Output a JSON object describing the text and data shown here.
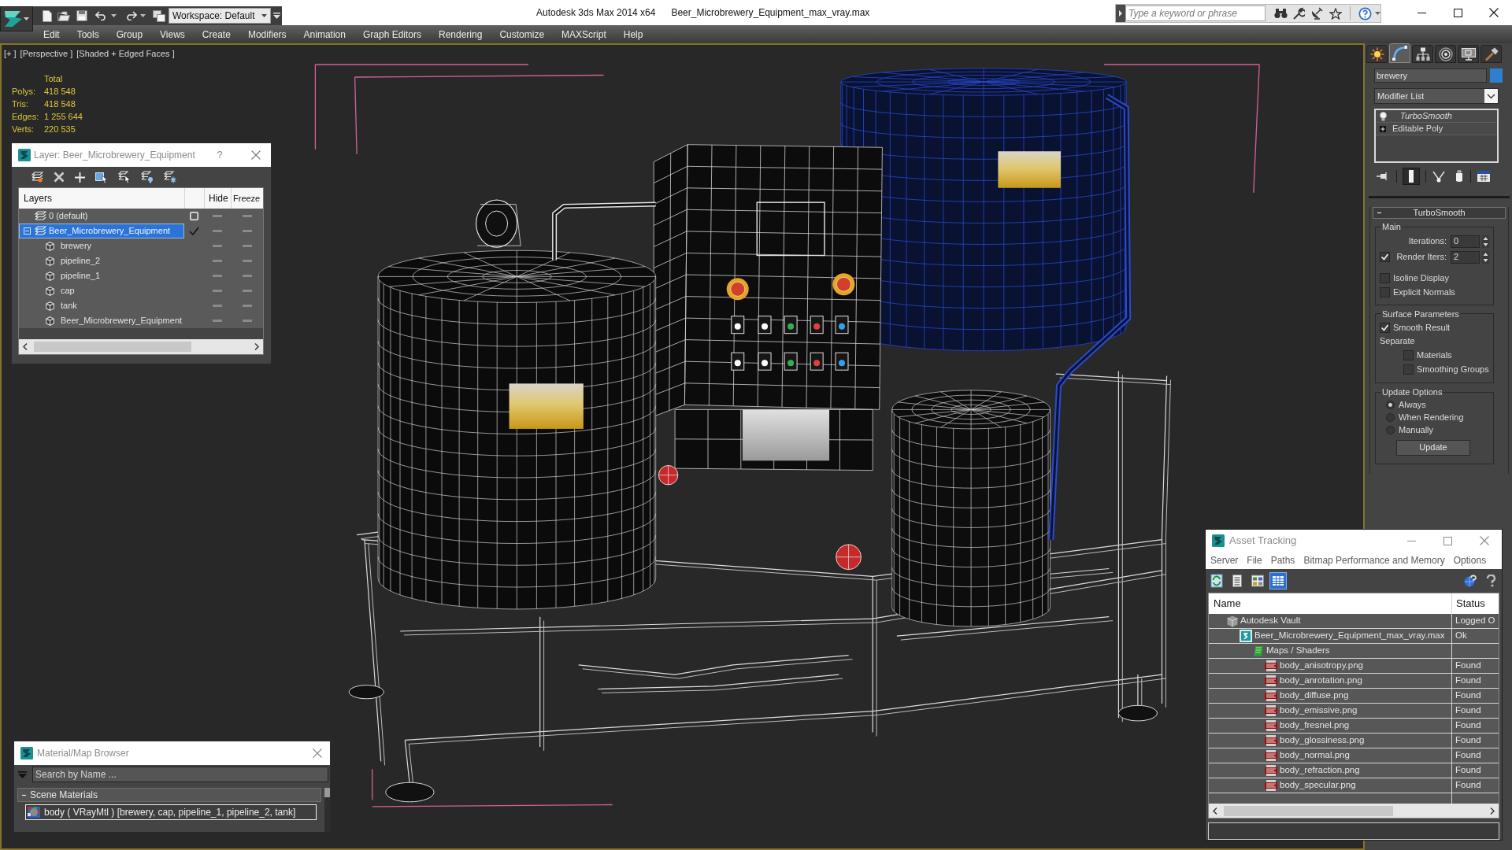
{
  "title_bar": {
    "workspace": "Workspace: Default",
    "app_title": "Autodesk 3ds Max 2014 x64",
    "file_name": "Beer_Microbrewery_Equipment_max_vray.max",
    "search": {
      "placeholder": "Type a keyword or phrase"
    }
  },
  "menu": [
    "Edit",
    "Tools",
    "Group",
    "Views",
    "Create",
    "Modifiers",
    "Animation",
    "Graph Editors",
    "Rendering",
    "Customize",
    "MAXScript",
    "Help"
  ],
  "viewport": {
    "labels": [
      "[+ ]",
      "[Perspective ]",
      "[Shaded + Edged Faces ]"
    ],
    "stats": {
      "header": "Total",
      "rows": [
        {
          "label": "Polys:",
          "value": "418 548"
        },
        {
          "label": "Tris:",
          "value": "418 548"
        },
        {
          "label": "Edges:",
          "value": "1 255 644"
        },
        {
          "label": "Verts:",
          "value": "220 535"
        }
      ]
    }
  },
  "layer_dialog": {
    "title": "Layer: Beer_Microbrewery_Equipment",
    "help": "?",
    "columns": {
      "name": "Layers",
      "hide": "Hide",
      "freeze": "Freeze"
    },
    "layers": [
      {
        "name": "0 (default)",
        "kind": "layer",
        "current": false,
        "selected": false,
        "hidden": false,
        "frozen": false
      },
      {
        "name": "Beer_Microbrewery_Equipment",
        "kind": "layer",
        "current": true,
        "selected": true,
        "expanded": true,
        "hidden": false,
        "frozen": false,
        "children": [
          {
            "name": "brewery",
            "kind": "object",
            "selected": false,
            "hidden": false,
            "frozen": false
          },
          {
            "name": "pipeline_2",
            "kind": "object",
            "selected": false,
            "hidden": false,
            "frozen": false
          },
          {
            "name": "pipeline_1",
            "kind": "object",
            "selected": false,
            "hidden": false,
            "frozen": false
          },
          {
            "name": "cap",
            "kind": "object",
            "selected": false,
            "hidden": false,
            "frozen": false
          },
          {
            "name": "tank",
            "kind": "object",
            "selected": false,
            "hidden": false,
            "frozen": false
          },
          {
            "name": "Beer_Microbrewery_Equipment",
            "kind": "object",
            "selected": false,
            "hidden": false,
            "frozen": false
          }
        ]
      }
    ]
  },
  "material_browser": {
    "title": "Material/Map Browser",
    "search": {
      "placeholder": "Search by Name ..."
    },
    "groups": [
      {
        "title": "Scene Materials",
        "expanded": true,
        "items": [
          {
            "name": "body ( VRayMtl ) [brewery, cap, pipeline_1, pipeline_2, tank]",
            "selected": true
          }
        ]
      }
    ]
  },
  "command_panel": {
    "tabs": [
      {
        "selected": false
      },
      {
        "selected": true
      },
      {
        "selected": false
      },
      {
        "selected": false
      },
      {
        "selected": false
      },
      {
        "selected": false
      }
    ],
    "object": {
      "name": "brewery",
      "color": "#2f7fd0"
    },
    "modifier_list": "Modifier List",
    "modifier_stack": [
      {
        "name": "TurboSmooth",
        "kind": "modifier",
        "on": true
      },
      {
        "name": "Editable Poly",
        "kind": "object",
        "expanded": false
      }
    ],
    "stack_tools": [
      {
        "on": false
      },
      {
        "on": true
      },
      {
        "on": false
      },
      {
        "on": false
      },
      {
        "on": false
      }
    ],
    "rollout": {
      "title": "TurboSmooth",
      "expanded": true,
      "groups": [
        {
          "title": "Main",
          "controls": [
            {
              "kind": "spinner",
              "label": "Iterations:",
              "value": "0"
            },
            {
              "kind": "check-spinner",
              "label": "Render Iters:",
              "value": "2",
              "checked": true
            },
            {
              "kind": "checkbox",
              "label": "Isoline Display",
              "checked": false
            },
            {
              "kind": "checkbox",
              "label": "Explicit Normals",
              "checked": false
            }
          ]
        },
        {
          "title": "Surface Parameters",
          "controls": [
            {
              "kind": "checkbox",
              "label": "Smooth Result",
              "checked": true
            },
            {
              "kind": "label",
              "label": "Separate"
            },
            {
              "kind": "subcheckbox",
              "label": "Materials",
              "checked": false
            },
            {
              "kind": "subcheckbox",
              "label": "Smoothing Groups",
              "checked": false
            }
          ]
        },
        {
          "title": "Update Options",
          "controls": [
            {
              "kind": "radio",
              "label": "Always",
              "selected": true
            },
            {
              "kind": "radio",
              "label": "When Rendering",
              "selected": false
            },
            {
              "kind": "radio",
              "label": "Manually",
              "selected": false
            },
            {
              "kind": "button",
              "label": "Update"
            }
          ]
        }
      ]
    }
  },
  "asset_tracking": {
    "title": "Asset Tracking",
    "menu": [
      "Server",
      "File",
      "Paths",
      "Bitmap Performance and Memory",
      "Options"
    ],
    "toolbar": [
      {
        "selected": false
      },
      {
        "selected": false
      },
      {
        "selected": false
      },
      {
        "selected": true
      }
    ],
    "columns": {
      "name": "Name",
      "status": "Status"
    },
    "tree": [
      {
        "name": "Autodesk Vault",
        "kind": "vault",
        "status": "Logged O",
        "children": [
          {
            "name": "Beer_Microbrewery_Equipment_max_vray.max",
            "kind": "scene",
            "status": "Ok",
            "children": [
              {
                "name": "Maps / Shaders",
                "kind": "folder",
                "children": [
                  {
                    "name": "body_anisotropy.png",
                    "kind": "png",
                    "status": "Found"
                  },
                  {
                    "name": "body_anrotation.png",
                    "kind": "png",
                    "status": "Found"
                  },
                  {
                    "name": "body_diffuse.png",
                    "kind": "png",
                    "status": "Found"
                  },
                  {
                    "name": "body_emissive.png",
                    "kind": "png",
                    "status": "Found"
                  },
                  {
                    "name": "body_fresnel.png",
                    "kind": "png",
                    "status": "Found"
                  },
                  {
                    "name": "body_glossiness.png",
                    "kind": "png",
                    "status": "Found"
                  },
                  {
                    "name": "body_normal.png",
                    "kind": "png",
                    "status": "Found"
                  },
                  {
                    "name": "body_refraction.png",
                    "kind": "png",
                    "status": "Found"
                  },
                  {
                    "name": "body_specular.png",
                    "kind": "png",
                    "status": "Found"
                  }
                ]
              }
            ]
          }
        ]
      }
    ]
  }
}
